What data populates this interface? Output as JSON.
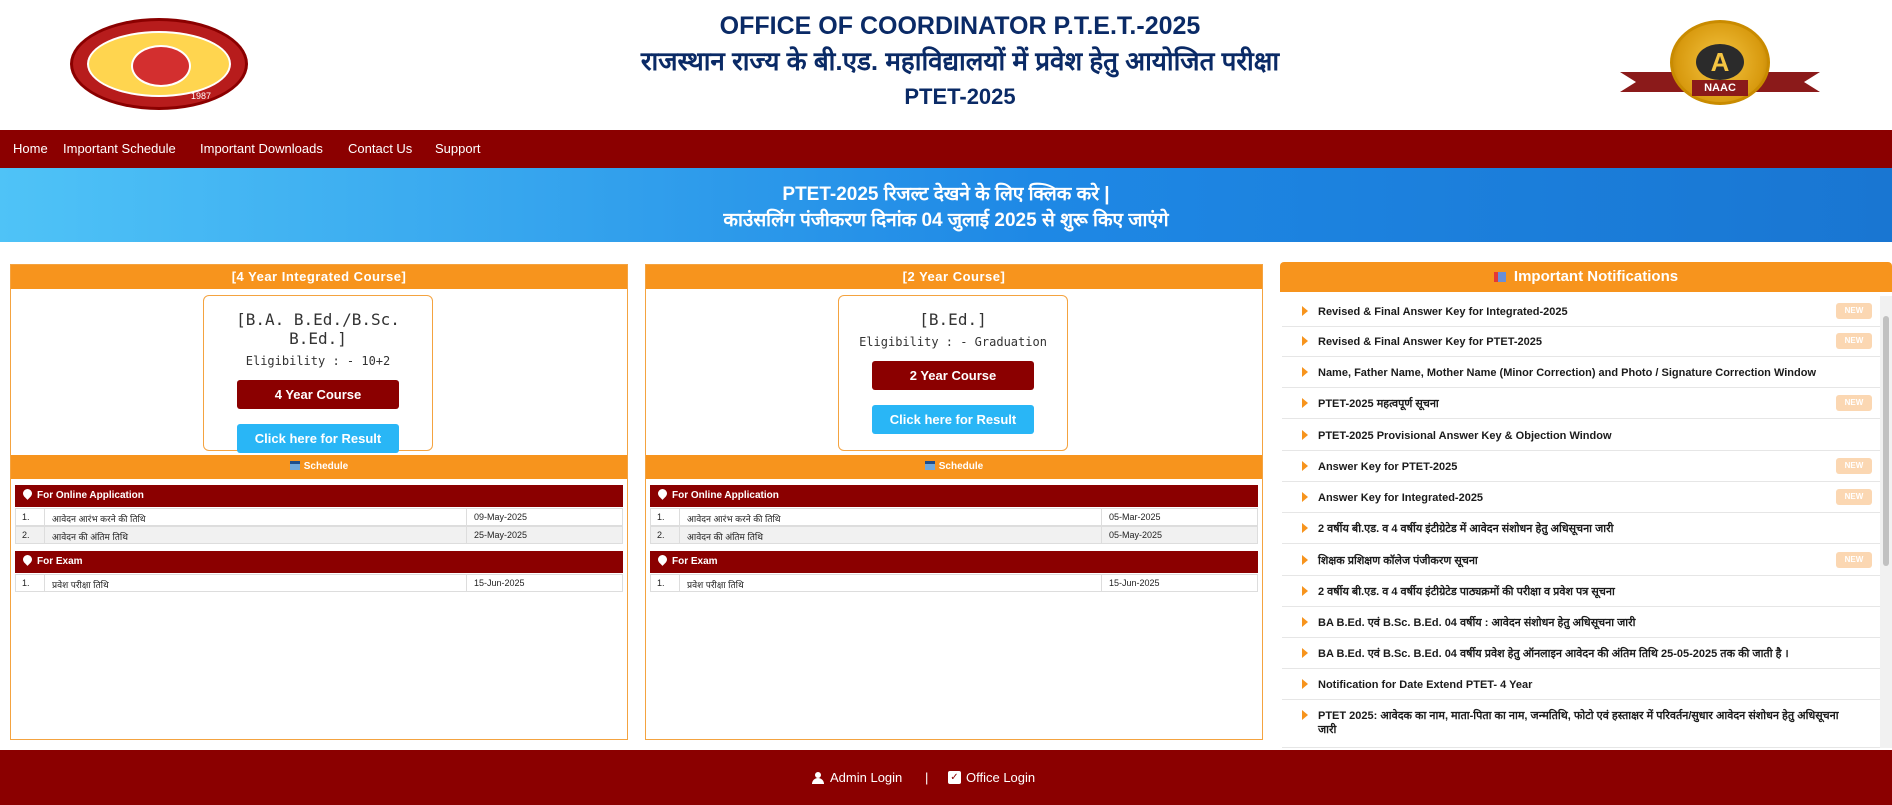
{
  "header": {
    "title_en": "OFFICE OF COORDINATOR P.T.E.T.-2025",
    "title_hi": "राजस्थान राज्य के बी.एड. महाविद्यालयों में प्रवेश हेतु आयोजित परीक्षा",
    "exam": "PTET-2025",
    "logo_year": "1987",
    "naac_grade": "A",
    "naac_label": "NAAC"
  },
  "nav": [
    "Home",
    "Important Schedule",
    "Important Downloads",
    "Contact Us",
    "Support"
  ],
  "banner": {
    "line1": "PTET-2025 रिजल्ट देखने के लिए क्लिक करे |",
    "line2": "काउंसलिंग पंजीकरण दिनांक 04 जुलाई 2025 से शुरू किए जाएंगे"
  },
  "courses": [
    {
      "header": "[4 Year Integrated Course]",
      "name": "[B.A. B.Ed./B.Sc. B.Ed.]",
      "eligibility": "Eligibility : - 10+2",
      "course_button": "4 Year Course",
      "result_button": "Click here for Result",
      "schedule_label": "Schedule",
      "online_label": "For Online Application",
      "online_rows": [
        {
          "n": "1.",
          "label": "आवेदन आरंभ करने की तिथि",
          "date": "09-May-2025"
        },
        {
          "n": "2.",
          "label": "आवेदन की अंतिम तिथि",
          "date": "25-May-2025"
        }
      ],
      "exam_label": "For Exam",
      "exam_rows": [
        {
          "n": "1.",
          "label": "प्रवेश परीक्षा तिथि",
          "date": "15-Jun-2025"
        }
      ]
    },
    {
      "header": "[2 Year Course]",
      "name": "[B.Ed.]",
      "eligibility": "Eligibility : - Graduation",
      "course_button": "2 Year Course",
      "result_button": "Click here for Result",
      "schedule_label": "Schedule",
      "online_label": "For Online Application",
      "online_rows": [
        {
          "n": "1.",
          "label": "आवेदन आरंभ करने की तिथि",
          "date": "05-Mar-2025"
        },
        {
          "n": "2.",
          "label": "आवेदन की अंतिम तिथि",
          "date": "05-May-2025"
        }
      ],
      "exam_label": "For Exam",
      "exam_rows": [
        {
          "n": "1.",
          "label": "प्रवेश परीक्षा तिथि",
          "date": "15-Jun-2025"
        }
      ]
    }
  ],
  "notifications": {
    "title": "Important Notifications",
    "new_label": "NEW",
    "items": [
      {
        "text": "Revised & Final Answer Key for Integrated-2025",
        "new": true
      },
      {
        "text": "Revised & Final Answer Key for PTET-2025",
        "new": true
      },
      {
        "text": "Name, Father Name, Mother Name (Minor Correction) and Photo / Signature Correction Window",
        "new": false
      },
      {
        "text": "PTET-2025 महत्वपूर्ण सूचना",
        "new": true
      },
      {
        "text": "PTET-2025 Provisional Answer Key & Objection Window",
        "new": false
      },
      {
        "text": "Answer Key for PTET-2025",
        "new": true
      },
      {
        "text": "Answer Key for Integrated-2025",
        "new": true
      },
      {
        "text": "2 वर्षीय बी.एड. व 4 वर्षीय इंटीग्रेटेड में आवेदन संशोधन हेतु अधिसूचना जारी",
        "new": false
      },
      {
        "text": "शिक्षक प्रशिक्षण कॉलेज पंजीकरण सूचना",
        "new": true
      },
      {
        "text": "2 वर्षीय बी.एड. व 4 वर्षीय इंटीग्रेटेड पाठ्यक्रमों की परीक्षा व प्रवेश पत्र सूचना",
        "new": false
      },
      {
        "text": "BA B.Ed. एवं B.Sc. B.Ed. 04 वर्षीय : आवेदन संशोधन हेतु अधिसूचना जारी",
        "new": false
      },
      {
        "text": "BA B.Ed. एवं B.Sc. B.Ed. 04 वर्षीय प्रवेश हेतु ऑनलाइन आवेदन की अंतिम तिथि 25-05-2025 तक की जाती है ।",
        "new": false
      },
      {
        "text": "Notification for Date Extend PTET- 4 Year",
        "new": false
      },
      {
        "text": "PTET 2025: आवेदक का नाम, माता-पिता का नाम, जन्मतिथि, फोटो एवं हस्ताक्षर में परिवर्तन/सुधार आवेदन संशोधन हेतु अधिसूचना जारी",
        "new": false
      }
    ]
  },
  "footer": {
    "admin_login": "Admin Login",
    "separator": "|",
    "office_login": "Office Login"
  }
}
